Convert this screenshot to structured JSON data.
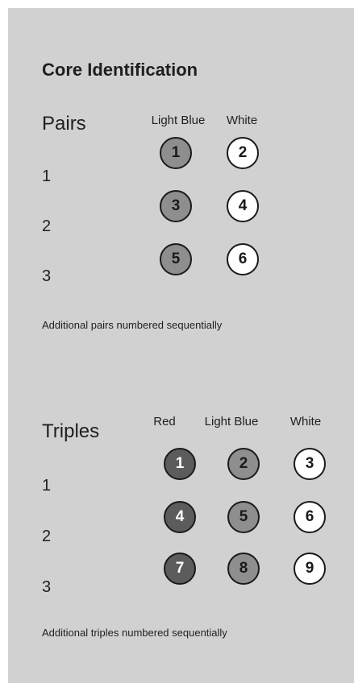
{
  "title": "Core Identification",
  "pairs": {
    "label": "Pairs",
    "columns": [
      {
        "name": "Light Blue",
        "fill": "#8e8e8e",
        "text": "#1a1a1a"
      },
      {
        "name": "White",
        "fill": "#ffffff",
        "text": "#1a1a1a"
      }
    ],
    "rows": [
      {
        "label": "1",
        "cores": [
          "1",
          "2"
        ]
      },
      {
        "label": "2",
        "cores": [
          "3",
          "4"
        ]
      },
      {
        "label": "3",
        "cores": [
          "5",
          "6"
        ]
      }
    ],
    "note": "Additional pairs numbered sequentially"
  },
  "triples": {
    "label": "Triples",
    "columns": [
      {
        "name": "Red",
        "fill": "#5c5c5c",
        "text": "#ffffff"
      },
      {
        "name": "Light Blue",
        "fill": "#8e8e8e",
        "text": "#1a1a1a"
      },
      {
        "name": "White",
        "fill": "#ffffff",
        "text": "#1a1a1a"
      }
    ],
    "rows": [
      {
        "label": "1",
        "cores": [
          "1",
          "2",
          "3"
        ]
      },
      {
        "label": "2",
        "cores": [
          "4",
          "5",
          "6"
        ]
      },
      {
        "label": "3",
        "cores": [
          "7",
          "8",
          "9"
        ]
      }
    ],
    "note": "Additional triples numbered sequentially"
  }
}
